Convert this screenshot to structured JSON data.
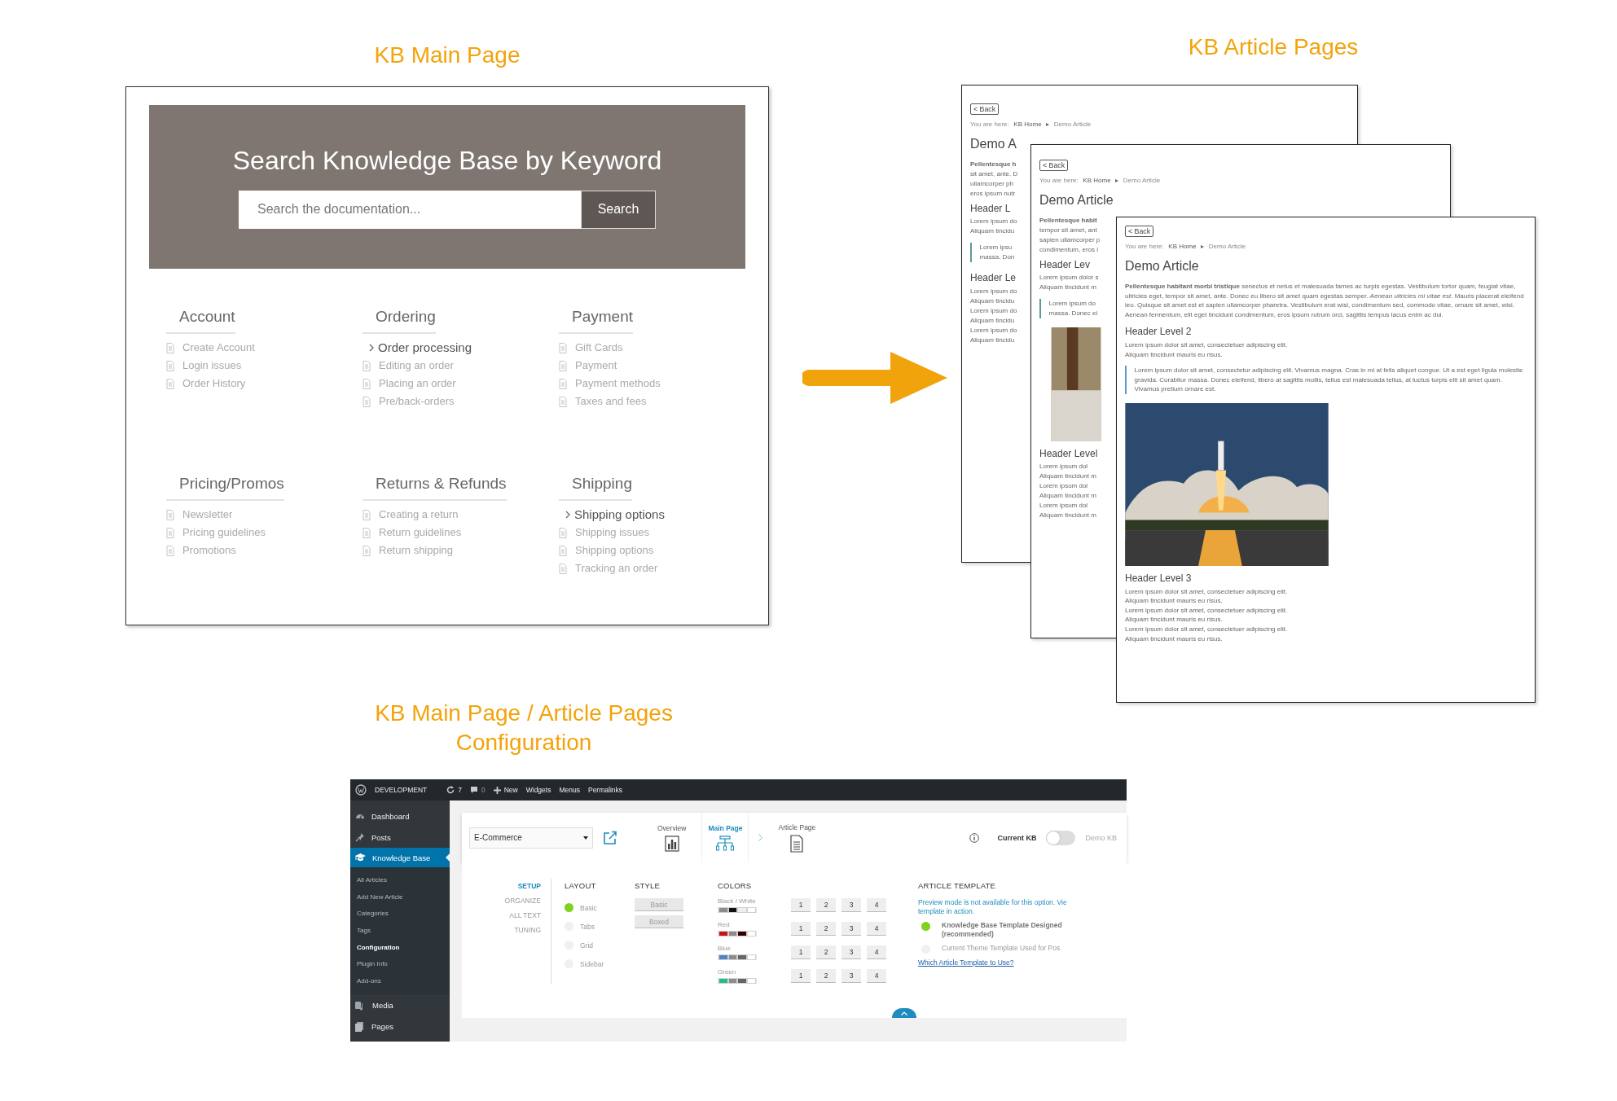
{
  "main_page": {
    "caption": "KB Main Page",
    "search": {
      "title": "Search Knowledge Base by Keyword",
      "placeholder": "Search the documentation...",
      "button": "Search"
    },
    "categories": [
      {
        "name": "Account",
        "items": [
          {
            "kind": "article",
            "label": "Create Account"
          },
          {
            "kind": "article",
            "label": "Login issues"
          },
          {
            "kind": "article",
            "label": "Order History"
          }
        ]
      },
      {
        "name": "Ordering",
        "items": [
          {
            "kind": "subcategory",
            "label": "Order processing"
          },
          {
            "kind": "article",
            "label": "Editing an order"
          },
          {
            "kind": "article",
            "label": "Placing an order"
          },
          {
            "kind": "article",
            "label": "Pre/back-orders"
          }
        ]
      },
      {
        "name": "Payment",
        "items": [
          {
            "kind": "article",
            "label": "Gift Cards"
          },
          {
            "kind": "article",
            "label": "Payment"
          },
          {
            "kind": "article",
            "label": "Payment methods"
          },
          {
            "kind": "article",
            "label": "Taxes and fees"
          }
        ]
      },
      {
        "name": "Pricing/Promos",
        "items": [
          {
            "kind": "article",
            "label": "Newsletter"
          },
          {
            "kind": "article",
            "label": "Pricing guidelines"
          },
          {
            "kind": "article",
            "label": "Promotions"
          }
        ]
      },
      {
        "name": "Returns & Refunds",
        "items": [
          {
            "kind": "article",
            "label": "Creating a return"
          },
          {
            "kind": "article",
            "label": "Return guidelines"
          },
          {
            "kind": "article",
            "label": "Return shipping"
          }
        ]
      },
      {
        "name": "Shipping",
        "items": [
          {
            "kind": "subcategory",
            "label": "Shipping options"
          },
          {
            "kind": "article",
            "label": "Shipping issues"
          },
          {
            "kind": "article",
            "label": "Shipping options"
          },
          {
            "kind": "article",
            "label": "Tracking an order"
          }
        ]
      }
    ]
  },
  "article_pages": {
    "caption": "KB Article Pages",
    "pages": [
      {
        "back": "< Back",
        "breadcrumb_label": "You are here:",
        "breadcrumb": [
          "KB Home",
          "Demo Article"
        ],
        "title": "Demo A",
        "blocks": [
          {
            "kind": "lines",
            "lines": [
              "**Pellentesque h**",
              "sit amet, ante. D",
              "ullamcorper ph",
              "eros ipsum nutr"
            ]
          },
          {
            "kind": "heading",
            "text": "Header L"
          },
          {
            "kind": "lines",
            "lines": [
              "Lorem ipsum do",
              "Aliquam tincidu"
            ]
          },
          {
            "kind": "quote",
            "lines": [
              "Lorem ipsu",
              "massa. Don"
            ]
          },
          {
            "kind": "heading",
            "text": "Header Le"
          },
          {
            "kind": "lines",
            "lines": [
              "Lorem ipsum do",
              "Aliquam tincidu",
              "Lorem ipsum do",
              "Aliquam tincidu",
              "Lorem ipsum do",
              "Aliquam tincidu"
            ]
          }
        ]
      },
      {
        "back": "< Back",
        "breadcrumb_label": "You are here:",
        "breadcrumb": [
          "KB Home",
          "Demo Article"
        ],
        "title": "Demo Article",
        "blocks": [
          {
            "kind": "lines",
            "lines": [
              "**Pellentesque habit**",
              "tempor sit amet, ant",
              "sapien ullamcorper p",
              "condimentum, eros i"
            ]
          },
          {
            "kind": "heading",
            "text": "Header Lev"
          },
          {
            "kind": "lines",
            "lines": [
              "Lorem ipsum dolor s",
              "Aliquam tincidunt m"
            ]
          },
          {
            "kind": "quote",
            "lines": [
              "Lorem ipsum do",
              "massa. Donec ei"
            ]
          },
          {
            "kind": "photo"
          },
          {
            "kind": "heading",
            "text": "Header Level"
          },
          {
            "kind": "lines",
            "lines": [
              "Lorem ipsum dol",
              "Aliquam tincidunt m",
              "Lorem ipsum dol",
              "Aliquam tincidunt m",
              "Lorem ipsum dol",
              "Aliquam tincidunt m"
            ]
          }
        ]
      },
      {
        "back": "< Back",
        "breadcrumb_label": "You are here:",
        "breadcrumb": [
          "KB Home",
          "Demo Article"
        ],
        "title": "Demo Article",
        "blocks": [
          {
            "kind": "para",
            "text": "**Pellentesque habitant morbi tristique** senectus et netus et malesuada fames ac turpis egestas. Vestibulum tortor quam, feugiat vitae, ultricies eget, tempor sit amet, ante. Donec eu libero sit amet quam egestas semper. *Aenean ultricies mi vitae est.* Mauris placerat eleifend leo. Quisque sit amet est et sapien ullamcorper pharetra. Vestibulum erat wisi, condimentum sed, commodo vitae, ornare sit amet, wisi. Aenean fermentum, elit eget tincidunt condimentum, eros ipsum rutrum orci, sagittis tempus lacus enim ac dui."
          },
          {
            "kind": "heading",
            "text": "Header Level 2"
          },
          {
            "kind": "lines",
            "lines": [
              "Lorem ipsum dolor sit amet, consectetuer adipiscing elit.",
              "Aliquam tincidunt mauris eu risus."
            ]
          },
          {
            "kind": "quote",
            "lines": [
              "Lorem ipsum dolor sit amet, consectetur adipiscing elit. Vivamus magna. Cras in mi at felis aliquet congue. Ut a est eget ligula molestie gravida. Curabitur massa. Donec eleifend, libero at sagittis mollis, tellus est malesuada tellus, at luctus turpis elit sit amet quam. Vivamus pretium ornare est."
            ]
          },
          {
            "kind": "photo"
          },
          {
            "kind": "heading",
            "text": "Header Level 3"
          },
          {
            "kind": "lines",
            "lines": [
              "Lorem ipsum dolor sit amet, consectetuer adipiscing elit.",
              "Aliquam tincidunt mauris eu risus.",
              "Lorem ipsum dolor sit amet, consectetuer adipiscing elit.",
              "Aliquam tincidunt mauris eu risus.",
              "Lorem ipsum dolor sit amet, consectetuer adipiscing elit.",
              "Aliquam tincidunt mauris eu risus."
            ]
          }
        ]
      }
    ]
  },
  "config": {
    "caption": "KB Main Page / Article Pages Configuration",
    "admin_bar": {
      "site": "DEVELOPMENT",
      "updates": "7",
      "comments": "0",
      "links": [
        "New",
        "Widgets",
        "Menus",
        "Permalinks"
      ]
    },
    "sidebar": {
      "items": [
        {
          "label": "Dashboard",
          "selected": false
        },
        {
          "label": "Posts",
          "selected": false
        },
        {
          "label": "Knowledge Base",
          "selected": true,
          "children": [
            {
              "label": "All Articles",
              "selected": false
            },
            {
              "label": "Add New Article",
              "selected": false
            },
            {
              "label": "Categories",
              "selected": false
            },
            {
              "label": "Tags",
              "selected": false
            },
            {
              "label": "Configuration",
              "selected": true
            },
            {
              "label": "Plugin Info",
              "selected": false
            },
            {
              "label": "Add-ons",
              "selected": false
            }
          ]
        },
        {
          "label": "Media",
          "selected": false
        },
        {
          "label": "Pages",
          "selected": false
        }
      ]
    },
    "toolbar": {
      "kb_select": "E-Commerce",
      "tabs": [
        {
          "label": "Overview",
          "selected": false
        },
        {
          "label": "Main Page",
          "selected": true
        },
        {
          "label": "Article Page",
          "selected": false
        }
      ],
      "current_kb": {
        "label": "Current KB",
        "on": false,
        "other": "Demo KB"
      }
    },
    "setup_nav": [
      {
        "label": "SETUP",
        "selected": true
      },
      {
        "label": "ORGANIZE",
        "selected": false
      },
      {
        "label": "ALL TEXT",
        "selected": false
      },
      {
        "label": "TUNING",
        "selected": false
      }
    ],
    "layout": {
      "title": "LAYOUT",
      "options": [
        {
          "label": "Basic",
          "selected": true
        },
        {
          "label": "Tabs",
          "selected": false
        },
        {
          "label": "Grid",
          "selected": false
        },
        {
          "label": "Sidebar",
          "selected": false
        }
      ]
    },
    "style": {
      "title": "STYLE",
      "buttons": [
        "Basic",
        "Boxed"
      ]
    },
    "colors": {
      "title": "COLORS",
      "rows": [
        {
          "name": "Black / White",
          "swatches": [
            {
              "color": "#8c8c8c"
            },
            {
              "color": "#111111"
            },
            {
              "color": "#eeeeee"
            },
            {
              "color": "#ffffff"
            }
          ],
          "buttons": [
            "1",
            "2",
            "3",
            "4"
          ]
        },
        {
          "name": "Red",
          "swatches": [
            {
              "color": "#cc1111"
            },
            {
              "color": "#8c8c8c"
            },
            {
              "color": "#330000"
            },
            {
              "color": "#ffffff"
            }
          ],
          "buttons": [
            "1",
            "2",
            "3",
            "4"
          ]
        },
        {
          "name": "Blue",
          "swatches": [
            {
              "color": "#4a86c8"
            },
            {
              "color": "#8c8c8c"
            },
            {
              "color": "#666666"
            },
            {
              "color": "#ffffff"
            }
          ],
          "buttons": [
            "1",
            "2",
            "3",
            "4"
          ]
        },
        {
          "name": "Green",
          "swatches": [
            {
              "color": "#1fbf8f"
            },
            {
              "color": "#8c8c8c"
            },
            {
              "color": "#666666"
            },
            {
              "color": "#ffffff"
            }
          ],
          "buttons": [
            "1",
            "2",
            "3",
            "4"
          ]
        }
      ]
    },
    "article_template": {
      "title": "ARTICLE TEMPLATE",
      "note_lines": [
        "Preview mode is not available for this option. Vie",
        "template in action."
      ],
      "options": [
        {
          "lines": [
            "Knowledge Base Template Designed",
            "(recommended)"
          ],
          "selected": true
        },
        {
          "lines": [
            "Current Theme Template Used for Pos"
          ],
          "selected": false
        }
      ],
      "link": "Which Article Template to Use?"
    }
  }
}
